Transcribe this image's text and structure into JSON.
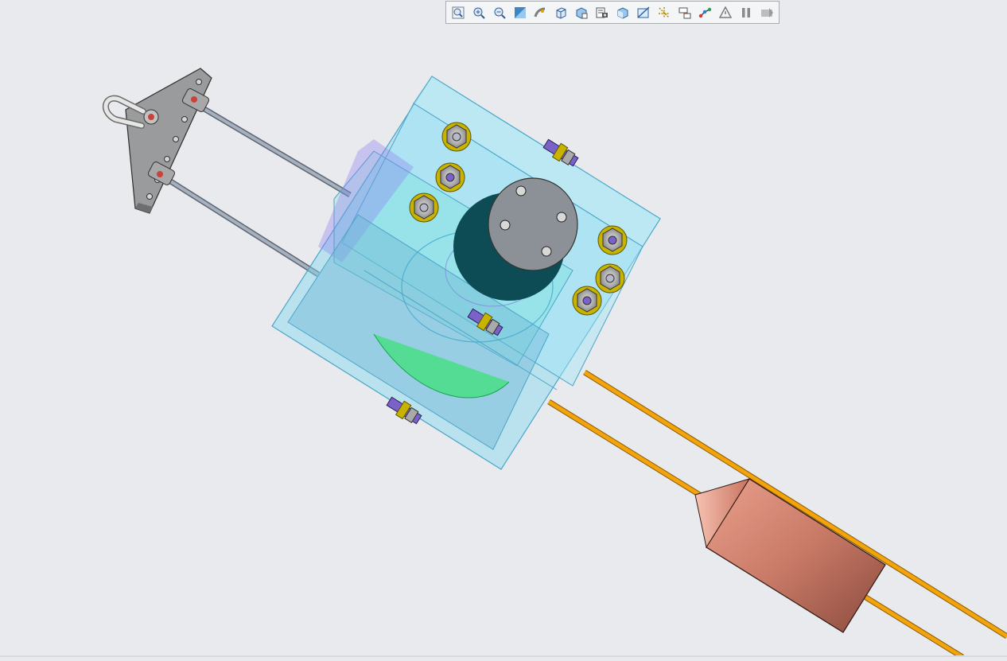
{
  "app": {
    "view": "3d-model-viewport",
    "background": "#e9eaed"
  },
  "toolbar": {
    "buttons": [
      {
        "name": "zoom-fit-button",
        "icon": "zoom-fit-icon"
      },
      {
        "name": "zoom-in-button",
        "icon": "zoom-in-icon"
      },
      {
        "name": "zoom-out-button",
        "icon": "zoom-out-icon"
      },
      {
        "name": "repaint-button",
        "icon": "repaint-icon"
      },
      {
        "name": "spin-center-button",
        "icon": "spin-center-icon"
      },
      {
        "name": "display-style-button",
        "icon": "display-style-icon"
      },
      {
        "name": "saved-orientations-button",
        "icon": "saved-orientations-icon"
      },
      {
        "name": "view-manager-button",
        "icon": "view-manager-icon"
      },
      {
        "name": "perspective-view-button",
        "icon": "perspective-icon"
      },
      {
        "name": "section-button",
        "icon": "section-icon"
      },
      {
        "name": "datum-display-button",
        "icon": "datum-display-icon"
      },
      {
        "name": "annotation-display-button",
        "icon": "annotation-display-icon"
      },
      {
        "name": "route-display-button",
        "icon": "route-display-icon"
      },
      {
        "name": "simplified-rep-button",
        "icon": "triangle-icon"
      },
      {
        "name": "pause-button",
        "icon": "pause-icon"
      },
      {
        "name": "next-button",
        "icon": "next-icon"
      }
    ]
  },
  "colors": {
    "housing": "#7fd7ef",
    "housing_edge": "#4aa6c9",
    "bracket": "#9a9b9c",
    "rod": "#8d97a6",
    "cable": "#f0a000",
    "weight": "#c97a67",
    "nut": "#c8b400",
    "bolt": "#7b62c8",
    "green_part": "#3fe07a"
  }
}
